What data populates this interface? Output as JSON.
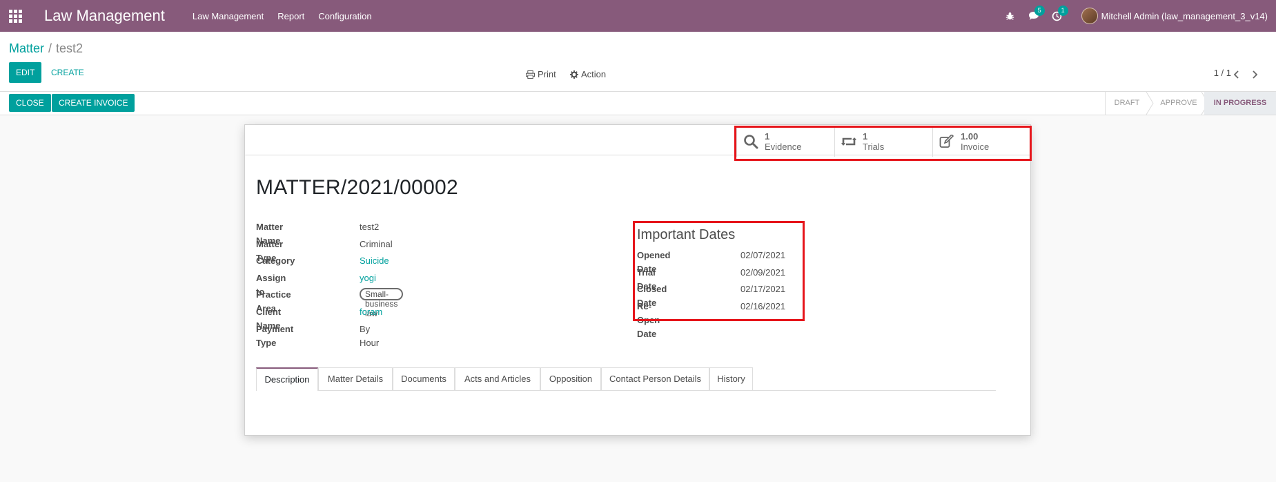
{
  "navbar": {
    "brand": "Law Management",
    "menu": [
      "Law Management",
      "Report",
      "Configuration"
    ],
    "messages_badge": "5",
    "activities_badge": "1",
    "user": "Mitchell Admin (law_management_3_v14)"
  },
  "breadcrumb": {
    "parent": "Matter",
    "separator": "/",
    "current": "test2"
  },
  "control": {
    "edit_label": "EDIT",
    "create_label": "CREATE",
    "print_label": "Print",
    "action_label": "Action",
    "pager": "1 / 1"
  },
  "statusbar": {
    "close_label": "CLOSE",
    "create_invoice_label": "CREATE INVOICE",
    "stages": [
      "DRAFT",
      "APPROVE",
      "IN PROGRESS"
    ],
    "active_stage": "IN PROGRESS"
  },
  "smart_buttons": [
    {
      "value": "1",
      "label": "Evidence",
      "icon": "search-icon"
    },
    {
      "value": "1",
      "label": "Trials",
      "icon": "retweet-icon"
    },
    {
      "value": "1.00",
      "label": "Invoice",
      "icon": "edit-icon"
    }
  ],
  "record": {
    "title": "MATTER/2021/00002",
    "fields": [
      {
        "label": "Matter Name",
        "value": "test2"
      },
      {
        "label": "Matter Type",
        "value": "Criminal"
      },
      {
        "label": "Category",
        "value": "Suicide"
      },
      {
        "label": "Assign to",
        "value": "yogi"
      },
      {
        "label": "Practice Area",
        "value": "Small-business law"
      },
      {
        "label": "Client Name",
        "value": "foram"
      },
      {
        "label": "Payment Type",
        "value": "By Hour"
      }
    ],
    "important_dates": {
      "title": "Important Dates",
      "fields": [
        {
          "label": "Opened Date",
          "value": "02/07/2021"
        },
        {
          "label": "Trial Date",
          "value": "02/09/2021"
        },
        {
          "label": "Closed Date",
          "value": "02/17/2021"
        },
        {
          "label": "Re-Open Date",
          "value": "02/16/2021"
        }
      ]
    }
  },
  "tabs": [
    "Description",
    "Matter Details",
    "Documents",
    "Acts and Articles",
    "Opposition",
    "Contact Person Details",
    "History"
  ],
  "colors": {
    "navbar": "#875a7b",
    "primary": "#00a09d",
    "highlight": "#e6151b"
  }
}
